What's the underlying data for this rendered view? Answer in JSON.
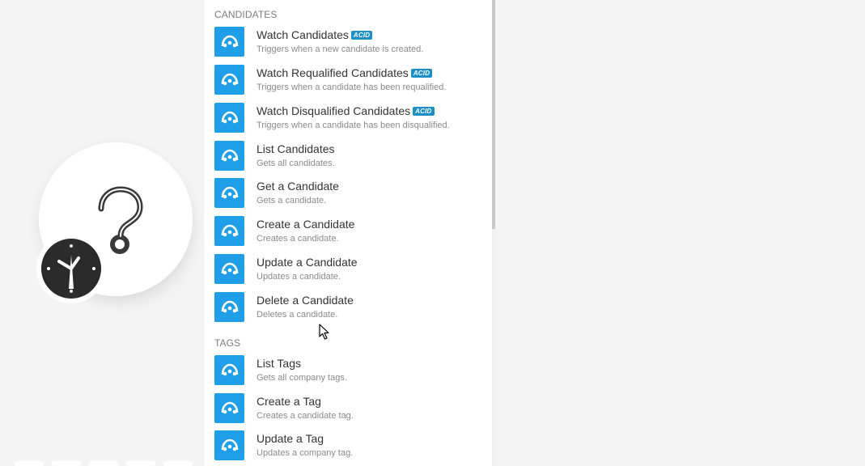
{
  "sections": [
    {
      "header": "Candidates",
      "items": [
        {
          "title": "Watch Candidates",
          "badge": "ACID",
          "desc": "Triggers when a new candidate is created."
        },
        {
          "title": "Watch Requalified Candidates",
          "badge": "ACID",
          "desc": "Triggers when a candidate has been requalified."
        },
        {
          "title": "Watch Disqualified Candidates",
          "badge": "ACID",
          "desc": "Triggers when a candidate has been disqualified."
        },
        {
          "title": "List Candidates",
          "desc": "Gets all candidates."
        },
        {
          "title": "Get a Candidate",
          "desc": "Gets a candidate."
        },
        {
          "title": "Create a Candidate",
          "desc": "Creates a candidate."
        },
        {
          "title": "Update a Candidate",
          "desc": "Updates a candidate."
        },
        {
          "title": "Delete a Candidate",
          "desc": "Deletes a candidate."
        }
      ]
    },
    {
      "header": "Tags",
      "items": [
        {
          "title": "List Tags",
          "desc": "Gets all company tags."
        },
        {
          "title": "Create a Tag",
          "desc": "Creates a candidate tag."
        },
        {
          "title": "Update a Tag",
          "desc": "Updates a company tag."
        }
      ]
    }
  ],
  "icons": {
    "module_icon": "app-logo-icon",
    "placeholder_module": "question-mark-icon",
    "scheduler": "clock-icon"
  },
  "colors": {
    "tile": "#1e9fe8",
    "badge": "#1b8fc6"
  }
}
